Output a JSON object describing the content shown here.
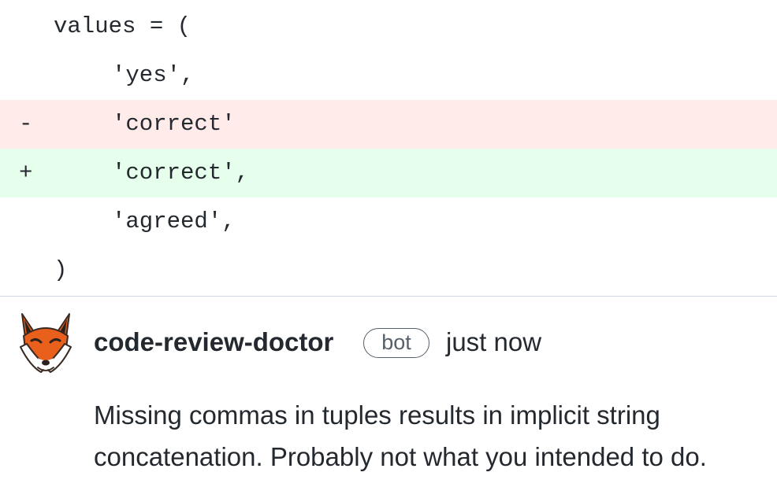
{
  "diff": {
    "lines": [
      {
        "marker": "",
        "code": "values = ("
      },
      {
        "marker": "",
        "code": "'yes',"
      },
      {
        "marker": "-",
        "code": "'correct'"
      },
      {
        "marker": "+",
        "code": "'correct',"
      },
      {
        "marker": "",
        "code": "'agreed',"
      },
      {
        "marker": "",
        "code": ")"
      }
    ],
    "colors": {
      "deletion_background": "#ffebe9",
      "addition_background": "#e6ffec"
    }
  },
  "comment": {
    "author": "code-review-doctor",
    "badge": "bot",
    "timestamp": "just now",
    "body": "Missing commas in tuples results in implicit string concatenation. Probably not what you intended to do.",
    "avatar_icon": "fox-avatar-icon"
  }
}
